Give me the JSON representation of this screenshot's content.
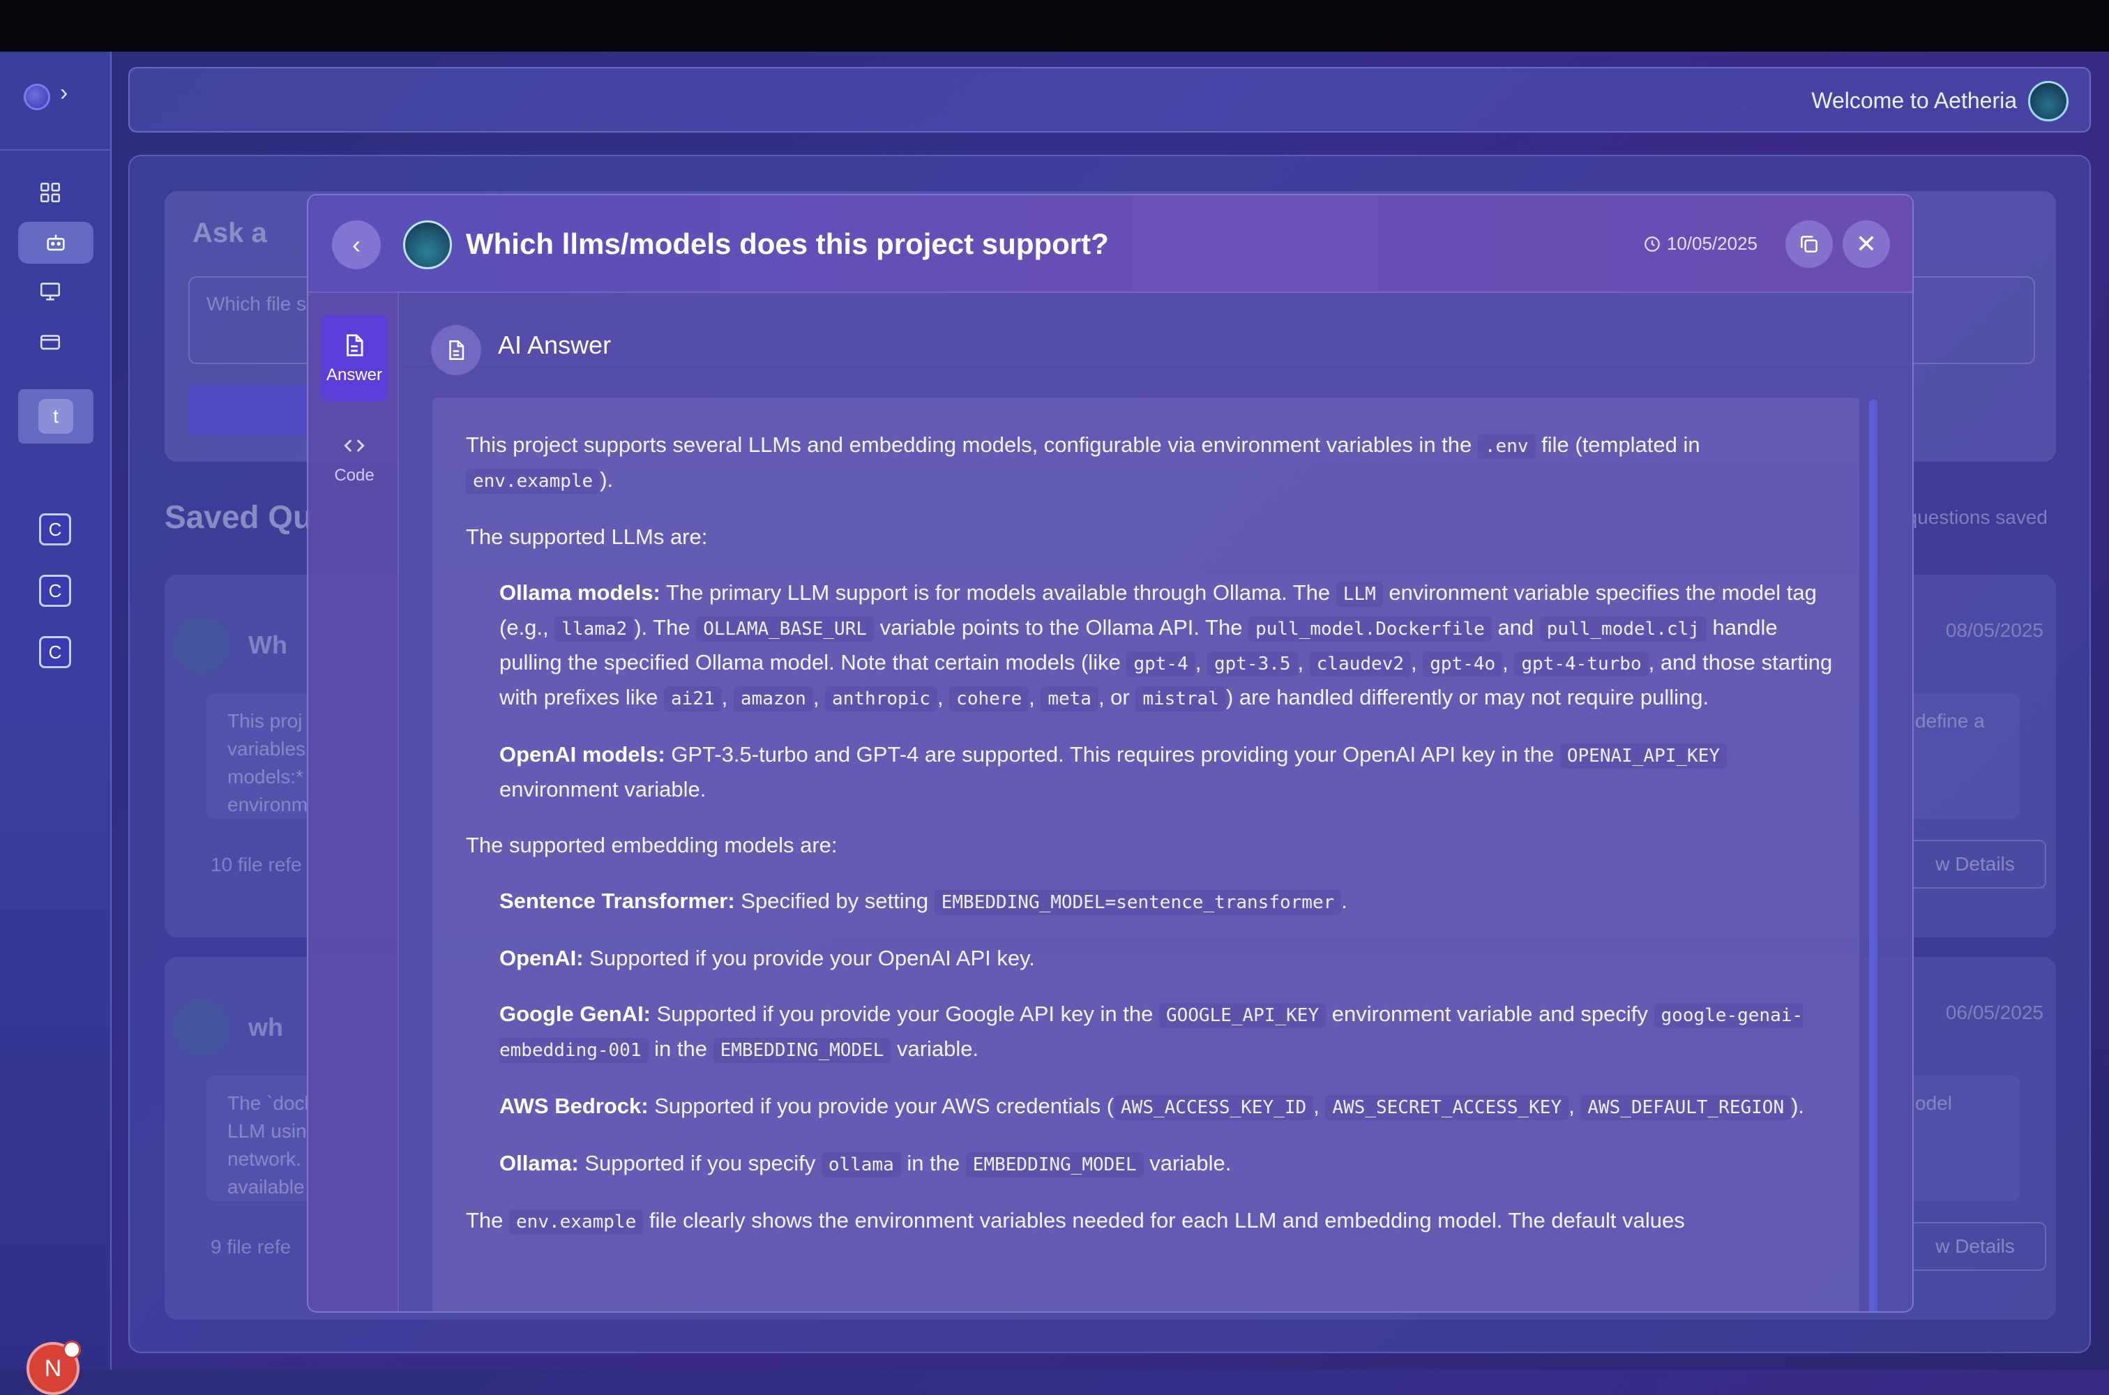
{
  "header": {
    "welcome_text": "Welcome to Aetheria"
  },
  "sidebar": {
    "chips": [
      {
        "letter": "t"
      },
      {
        "letter": "C"
      },
      {
        "letter": "C"
      },
      {
        "letter": "C"
      }
    ],
    "user_initial": "N"
  },
  "background": {
    "ask_title": "Ask a",
    "ask_placeholder": "Which file s",
    "saved_title": "Saved Qu",
    "saved_count": "questions saved",
    "cards": [
      {
        "title": "Wh",
        "date": "08/05/2025",
        "text_lines": [
          "This proj",
          "variables",
          "models:*",
          "environm"
        ],
        "right_text": "define a",
        "refs": "10 file refe",
        "btn": "w Details"
      },
      {
        "title": "wh",
        "date": "06/05/2025",
        "text_lines": [
          "The `dock",
          "LLM usin",
          "network.",
          "available"
        ],
        "right_text": "odel",
        "refs": "9 file refe",
        "btn": "w Details"
      }
    ]
  },
  "modal": {
    "title": "Which llms/models does this project support?",
    "date": "10/05/2025",
    "tabs": [
      {
        "label": "Answer"
      },
      {
        "label": "Code"
      }
    ],
    "answer_heading": "AI Answer"
  },
  "answer": {
    "p1a": "This project supports several LLMs and embedding models, configurable via environment variables in the ",
    "p1_code1": ".env",
    "p1b": " file (templated in ",
    "p1_code2": "env.example",
    "p1c": ").",
    "p2": "The supported LLMs are:",
    "ollama_label": "Ollama models:",
    "ollama_a": " The primary LLM support is for models available through Ollama. The ",
    "ollama_c1": "LLM",
    "ollama_b": " environment variable specifies the model tag (e.g., ",
    "ollama_c2": "llama2",
    "ollama_c": "). The ",
    "ollama_c3": "OLLAMA_BASE_URL",
    "ollama_d": " variable points to the Ollama API. The ",
    "ollama_c4": "pull_model.Dockerfile",
    "ollama_e": " and ",
    "ollama_c5": "pull_model.clj",
    "ollama_f": " handle pulling the specified Ollama model. Note that certain models (like ",
    "ollama_c6": "gpt-4",
    "ollama_c7": "gpt-3.5",
    "ollama_c8": "claudev2",
    "ollama_c9": "gpt-4o",
    "ollama_c10": "gpt-4-turbo",
    "ollama_g": ", and those starting with prefixes like ",
    "ollama_c11": "ai21",
    "ollama_c12": "amazon",
    "ollama_c13": "anthropic",
    "ollama_c14": "cohere",
    "ollama_c15": "meta",
    "ollama_h": ", or ",
    "ollama_c16": "mistral",
    "ollama_i": ") are handled differently or may not require pulling.",
    "openai_label": "OpenAI models:",
    "openai_a": " GPT-3.5-turbo and GPT-4 are supported. This requires providing your OpenAI API key in the ",
    "openai_c1": "OPENAI_API_KEY",
    "openai_b": " environment variable.",
    "p3": "The supported embedding models are:",
    "st_label": "Sentence Transformer:",
    "st_a": " Specified by setting ",
    "st_c1": "EMBEDDING_MODEL=sentence_transformer",
    "st_b": ".",
    "oa_label": "OpenAI:",
    "oa_a": " Supported if you provide your OpenAI API key.",
    "gg_label": "Google GenAI:",
    "gg_a": " Supported if you provide your Google API key in the ",
    "gg_c1": "GOOGLE_API_KEY",
    "gg_b": " environment variable and specify ",
    "gg_c2": "google-genai-embedding-001",
    "gg_c": " in the ",
    "gg_c3": "EMBEDDING_MODEL",
    "gg_d": " variable.",
    "aws_label": "AWS Bedrock:",
    "aws_a": " Supported if you provide your AWS credentials (",
    "aws_c1": "AWS_ACCESS_KEY_ID",
    "aws_c2": "AWS_SECRET_ACCESS_KEY",
    "aws_c3": "AWS_DEFAULT_REGION",
    "aws_b": ").",
    "ol_label": "Ollama:",
    "ol_a": " Supported if you specify ",
    "ol_c1": "ollama",
    "ol_b": " in the ",
    "ol_c2": "EMBEDDING_MODEL",
    "ol_c": " variable.",
    "last_a": "The ",
    "last_c1": "env.example",
    "last_b": " file clearly shows the environment variables needed for each LLM and embedding model. The default values",
    "comma": ", "
  },
  "colors": {
    "accent": "#5b3fd8",
    "avatar_n": "#d84135",
    "scrollbar": "#5a5cd8"
  }
}
